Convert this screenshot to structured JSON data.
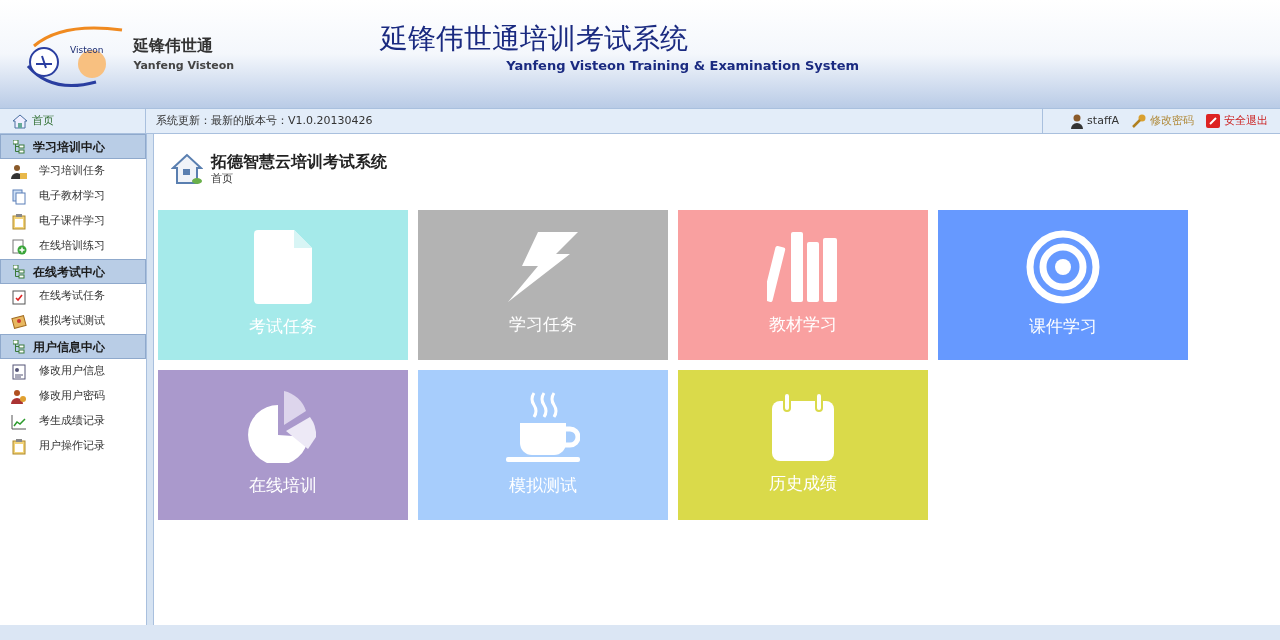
{
  "header": {
    "brand_cn": "延锋伟世通",
    "brand_en": "Yanfeng Visteon",
    "logo_text": "Visteon",
    "title_cn": "延锋伟世通培训考试系统",
    "title_en": "Yanfeng Visteon Training & Examination System"
  },
  "toolbar": {
    "home": "首页",
    "notice": "系统更新：最新的版本号：V1.0.20130426",
    "user": "staffA",
    "change_password": "修改密码",
    "logout": "安全退出"
  },
  "sidebar": {
    "sections": [
      {
        "title": "学习培训中心",
        "items": [
          {
            "label": "学习培训任务",
            "kind": "user"
          },
          {
            "label": "电子教材学习",
            "kind": "docs"
          },
          {
            "label": "电子课件学习",
            "kind": "clipboard"
          },
          {
            "label": "在线培训练习",
            "kind": "add"
          }
        ]
      },
      {
        "title": "在线考试中心",
        "items": [
          {
            "label": "在线考试任务",
            "kind": "check"
          },
          {
            "label": "模拟考试测试",
            "kind": "note"
          }
        ]
      },
      {
        "title": "用户信息中心",
        "items": [
          {
            "label": "修改用户信息",
            "kind": "card"
          },
          {
            "label": "修改用户密码",
            "kind": "key"
          },
          {
            "label": "考生成绩记录",
            "kind": "chart"
          },
          {
            "label": "用户操作记录",
            "kind": "clipboard"
          }
        ]
      }
    ]
  },
  "page": {
    "title": "拓德智慧云培训考试系统",
    "breadcrumb": "首页"
  },
  "tiles": [
    {
      "label": "考试任务",
      "kind": "document",
      "color": "#a5eaea"
    },
    {
      "label": "学习任务",
      "kind": "lightning",
      "color": "#b3b3b3"
    },
    {
      "label": "教材学习",
      "kind": "books",
      "color": "#f9a0a0"
    },
    {
      "label": "课件学习",
      "kind": "target",
      "color": "#6699ff"
    },
    {
      "label": "在线培训",
      "kind": "pie",
      "color": "#aa99cc"
    },
    {
      "label": "模拟测试",
      "kind": "coffee",
      "color": "#a7cdfc"
    },
    {
      "label": "历史成绩",
      "kind": "calendar",
      "color": "#dada4a"
    }
  ]
}
